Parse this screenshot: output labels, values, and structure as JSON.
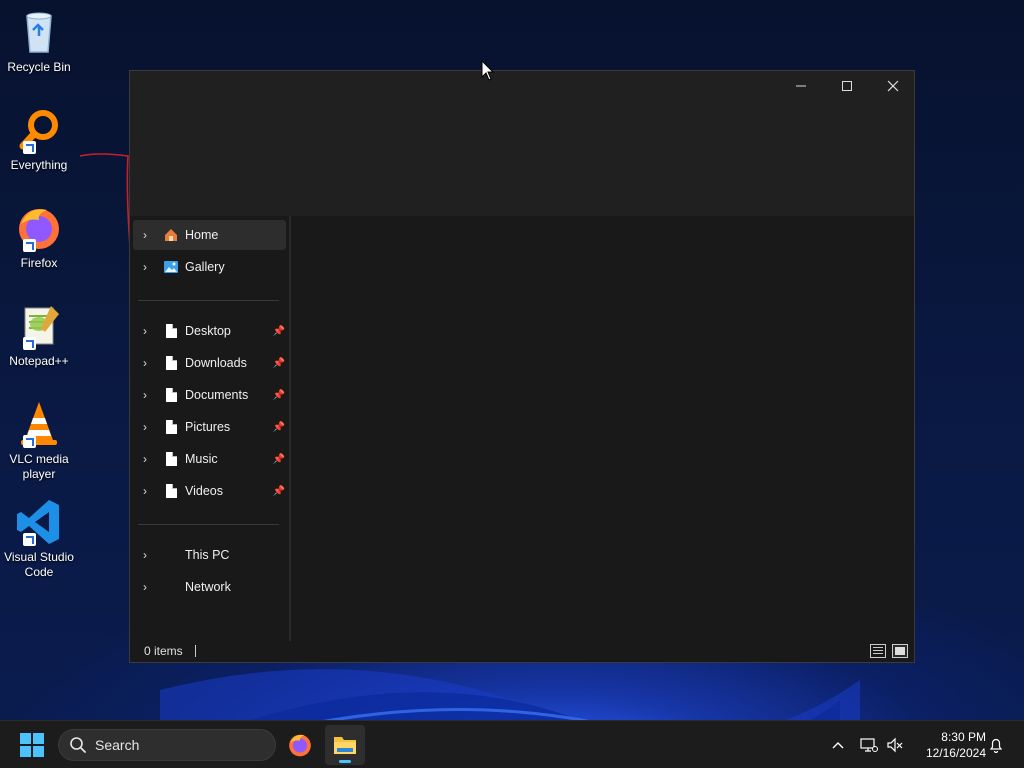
{
  "desktop": {
    "icons": [
      {
        "label": "Recycle Bin",
        "icon": "recycle-bin-icon"
      },
      {
        "label": "Everything",
        "icon": "everything-icon"
      },
      {
        "label": "Firefox",
        "icon": "firefox-icon"
      },
      {
        "label": "Notepad++",
        "icon": "notepadpp-icon"
      },
      {
        "label": "VLC media player",
        "icon": "vlc-icon"
      },
      {
        "label": "Visual Studio Code",
        "icon": "vscode-icon"
      }
    ]
  },
  "window": {
    "controls": {
      "minimize": "—",
      "maximize": "☐",
      "close": "✕"
    },
    "nav": {
      "top": [
        {
          "label": "Home",
          "icon": "home-icon",
          "selected": true
        },
        {
          "label": "Gallery",
          "icon": "gallery-icon"
        }
      ],
      "pinned": [
        {
          "label": "Desktop"
        },
        {
          "label": "Downloads"
        },
        {
          "label": "Documents"
        },
        {
          "label": "Pictures"
        },
        {
          "label": "Music"
        },
        {
          "label": "Videos"
        }
      ],
      "bottom": [
        {
          "label": "This PC"
        },
        {
          "label": "Network"
        }
      ]
    },
    "status": {
      "items": "0 items"
    }
  },
  "taskbar": {
    "search_placeholder": "Search",
    "clock": {
      "time": "8:30 PM",
      "date": "12/16/2024"
    }
  },
  "colors": {
    "accent": "#4cc2ff",
    "window_bg": "#191919",
    "titlebar_bg": "#202020"
  }
}
